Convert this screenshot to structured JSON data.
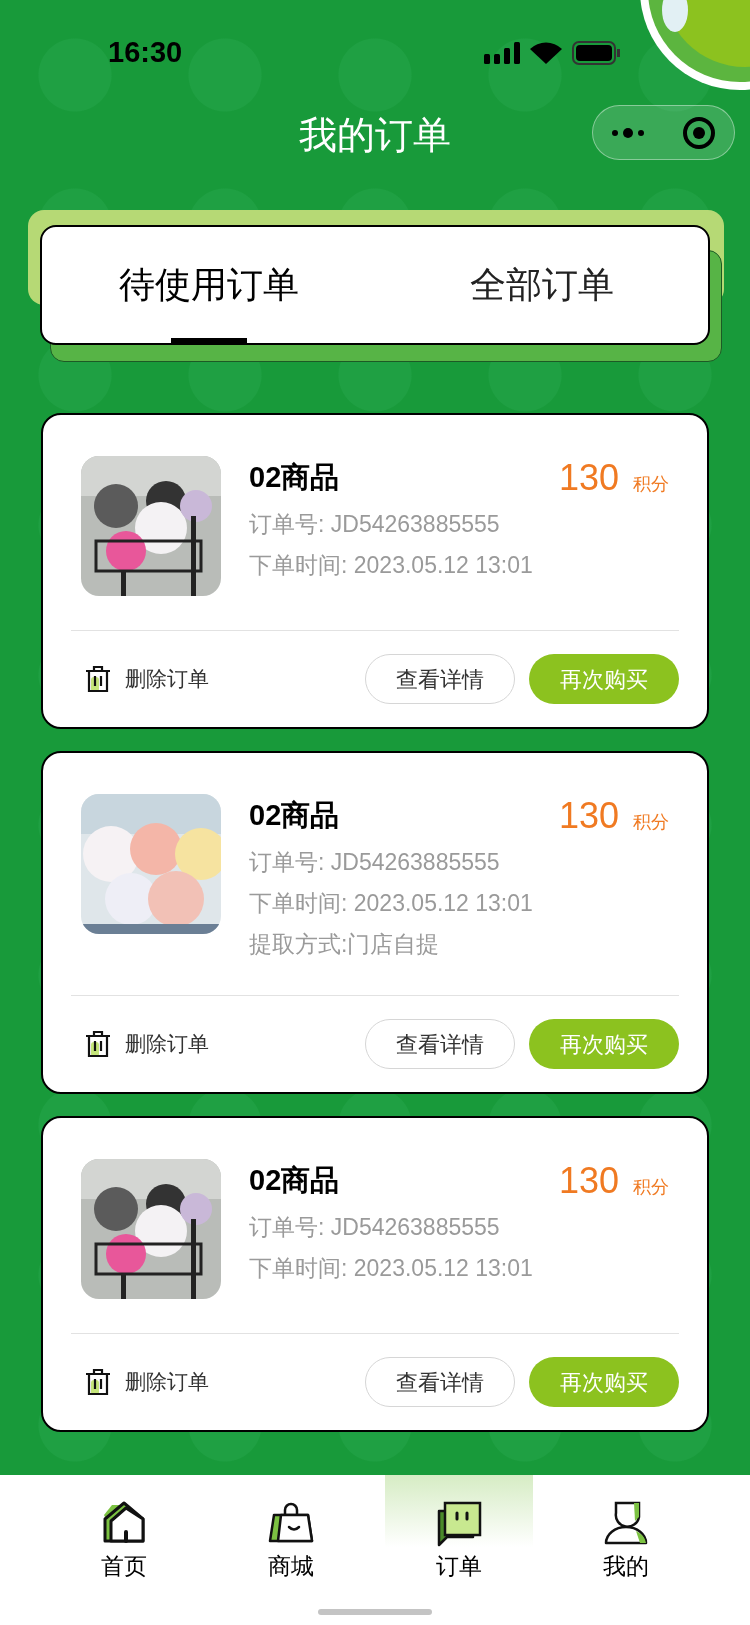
{
  "status_bar": {
    "time": "16:30"
  },
  "header": {
    "title": "我的订单"
  },
  "tabs": [
    {
      "label": "待使用订单",
      "selected": true
    },
    {
      "label": "全部订单",
      "selected": false
    }
  ],
  "orders": [
    {
      "title": "02商品",
      "price": "130",
      "unit": "积分",
      "lines": [
        "订单号: JD54263885555",
        "下单时间: 2023.05.12 13:01"
      ],
      "delete": "删除订单",
      "buttons": [
        {
          "label": "查看详情",
          "kind": "outline"
        },
        {
          "label": "再次购买",
          "kind": "primary"
        }
      ]
    },
    {
      "title": "02商品",
      "price": "130",
      "unit": "积分",
      "lines": [
        "订单号: JD54263885555",
        "下单时间: 2023.05.12 13:01",
        "提取方式:门店自提"
      ],
      "delete": "删除订单",
      "buttons": [
        {
          "label": "查看详情",
          "kind": "outline"
        },
        {
          "label": "再次购买",
          "kind": "primary"
        }
      ]
    },
    {
      "title": "02商品",
      "price": "130",
      "unit": "积分",
      "lines": [
        "订单号: JD54263885555",
        "下单时间: 2023.05.12 13:01"
      ],
      "delete": "删除订单",
      "buttons": [
        {
          "label": "查看详情",
          "kind": "outline"
        },
        {
          "label": "再次购买",
          "kind": "primary"
        }
      ]
    }
  ],
  "nav": [
    {
      "label": "首页",
      "kind": "home",
      "selected": false
    },
    {
      "label": "商城",
      "kind": "shop",
      "selected": false
    },
    {
      "label": "订单",
      "kind": "orders",
      "selected": true
    },
    {
      "label": "我的",
      "kind": "me",
      "selected": false
    }
  ]
}
